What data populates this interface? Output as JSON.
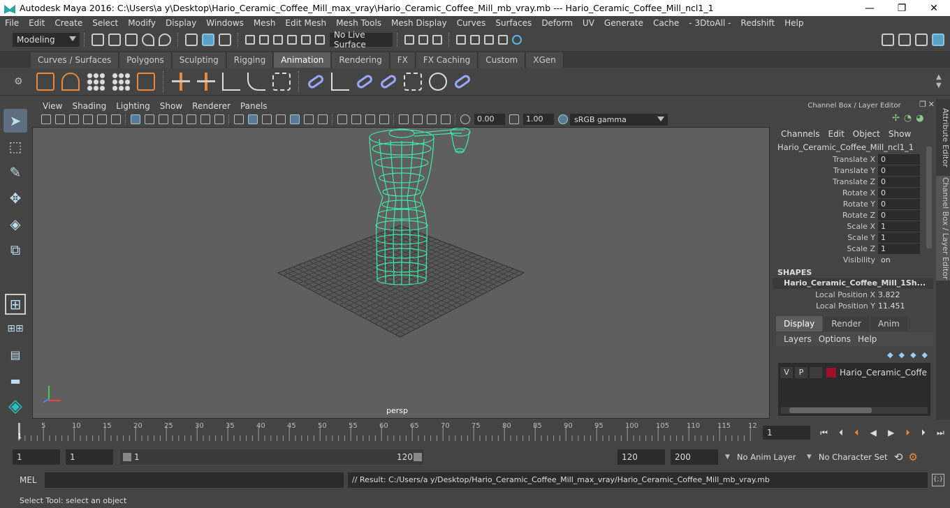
{
  "window": {
    "title": "Autodesk Maya 2016: C:\\Users\\a y\\Desktop\\Hario_Ceramic_Coffee_Mill_max_vray\\Hario_Ceramic_Coffee_Mill_mb_vray.mb   ---   Hario_Ceramic_Coffee_Mill_ncl1_1",
    "minimize": "—",
    "maximize": "❐",
    "close": "✕"
  },
  "menubar": [
    "File",
    "Edit",
    "Create",
    "Select",
    "Modify",
    "Display",
    "Windows",
    "Mesh",
    "Edit Mesh",
    "Mesh Tools",
    "Mesh Display",
    "Curves",
    "Surfaces",
    "Deform",
    "UV",
    "Generate",
    "Cache",
    "- 3DtoAll -",
    "Redshift",
    "Help"
  ],
  "statusline": {
    "mode": "Modeling",
    "live_surface": "No Live Surface"
  },
  "shelf_tabs": [
    {
      "label": "Curves / Surfaces",
      "active": false
    },
    {
      "label": "Polygons",
      "active": false
    },
    {
      "label": "Sculpting",
      "active": false
    },
    {
      "label": "Rigging",
      "active": false
    },
    {
      "label": "Animation",
      "active": true
    },
    {
      "label": "Rendering",
      "active": false
    },
    {
      "label": "FX",
      "active": false
    },
    {
      "label": "FX Caching",
      "active": false
    },
    {
      "label": "Custom",
      "active": false
    },
    {
      "label": "XGen",
      "active": false
    }
  ],
  "viewport": {
    "menu": [
      "View",
      "Shading",
      "Lighting",
      "Show",
      "Renderer",
      "Panels"
    ],
    "exposure": "0.00",
    "gamma": "1.00",
    "colorspace": "sRGB gamma",
    "camera_label": "persp"
  },
  "channel_box": {
    "header": "Channel Box / Layer Editor",
    "menu": [
      "Channels",
      "Edit",
      "Object",
      "Show"
    ],
    "object": "Hario_Ceramic_Coffee_Mill_ncl1_1",
    "attributes": [
      {
        "label": "Translate X",
        "value": "0"
      },
      {
        "label": "Translate Y",
        "value": "0"
      },
      {
        "label": "Translate Z",
        "value": "0"
      },
      {
        "label": "Rotate X",
        "value": "0"
      },
      {
        "label": "Rotate Y",
        "value": "0"
      },
      {
        "label": "Rotate Z",
        "value": "0"
      },
      {
        "label": "Scale X",
        "value": "1"
      },
      {
        "label": "Scale Y",
        "value": "1"
      },
      {
        "label": "Scale Z",
        "value": "1"
      },
      {
        "label": "Visibility",
        "value": "on"
      }
    ],
    "shapes_label": "SHAPES",
    "shape_name": "Hario_Ceramic_Coffee_Mill_1Sh...",
    "shape_attrs": [
      {
        "label": "Local Position X",
        "value": "3.822"
      },
      {
        "label": "Local Position Y",
        "value": "11.451"
      }
    ]
  },
  "layer_editor": {
    "tabs": [
      {
        "label": "Display",
        "active": true
      },
      {
        "label": "Render",
        "active": false
      },
      {
        "label": "Anim",
        "active": false
      }
    ],
    "menu": [
      "Layers",
      "Options",
      "Help"
    ],
    "layer": {
      "v": "V",
      "p": "P",
      "name": "Hario_Ceramic_Coffee_M",
      "color": "#a0102a"
    }
  },
  "side_tabs": {
    "attribute_editor": "Attribute Editor",
    "channel_box": "Channel Box / Layer Editor"
  },
  "time_slider": {
    "ticks": [
      "5",
      "10",
      "15",
      "20",
      "25",
      "30",
      "35",
      "40",
      "45",
      "50",
      "55",
      "60",
      "65",
      "70",
      "75",
      "80",
      "85",
      "90",
      "95",
      "100",
      "105",
      "110",
      "115",
      "12"
    ],
    "start_label": "1",
    "current_frame": "1"
  },
  "range_slider": {
    "start": "1",
    "anim_start": "1",
    "range_start": "1",
    "range_end": "120",
    "end": "120",
    "anim_end": "200",
    "anim_layer": "No Anim Layer",
    "character_set": "No Character Set"
  },
  "command_line": {
    "label": "MEL",
    "result": "// Result: C:/Users/a y/Desktop/Hario_Ceramic_Coffee_Mill_max_vray/Hario_Ceramic_Coffee_Mill_mb_vray.mb"
  },
  "help_line": "Select Tool: select an object",
  "colors": {
    "wireframe": "#3fe9a8",
    "accent": "#5d5d5d",
    "layer": "#a0102a"
  }
}
